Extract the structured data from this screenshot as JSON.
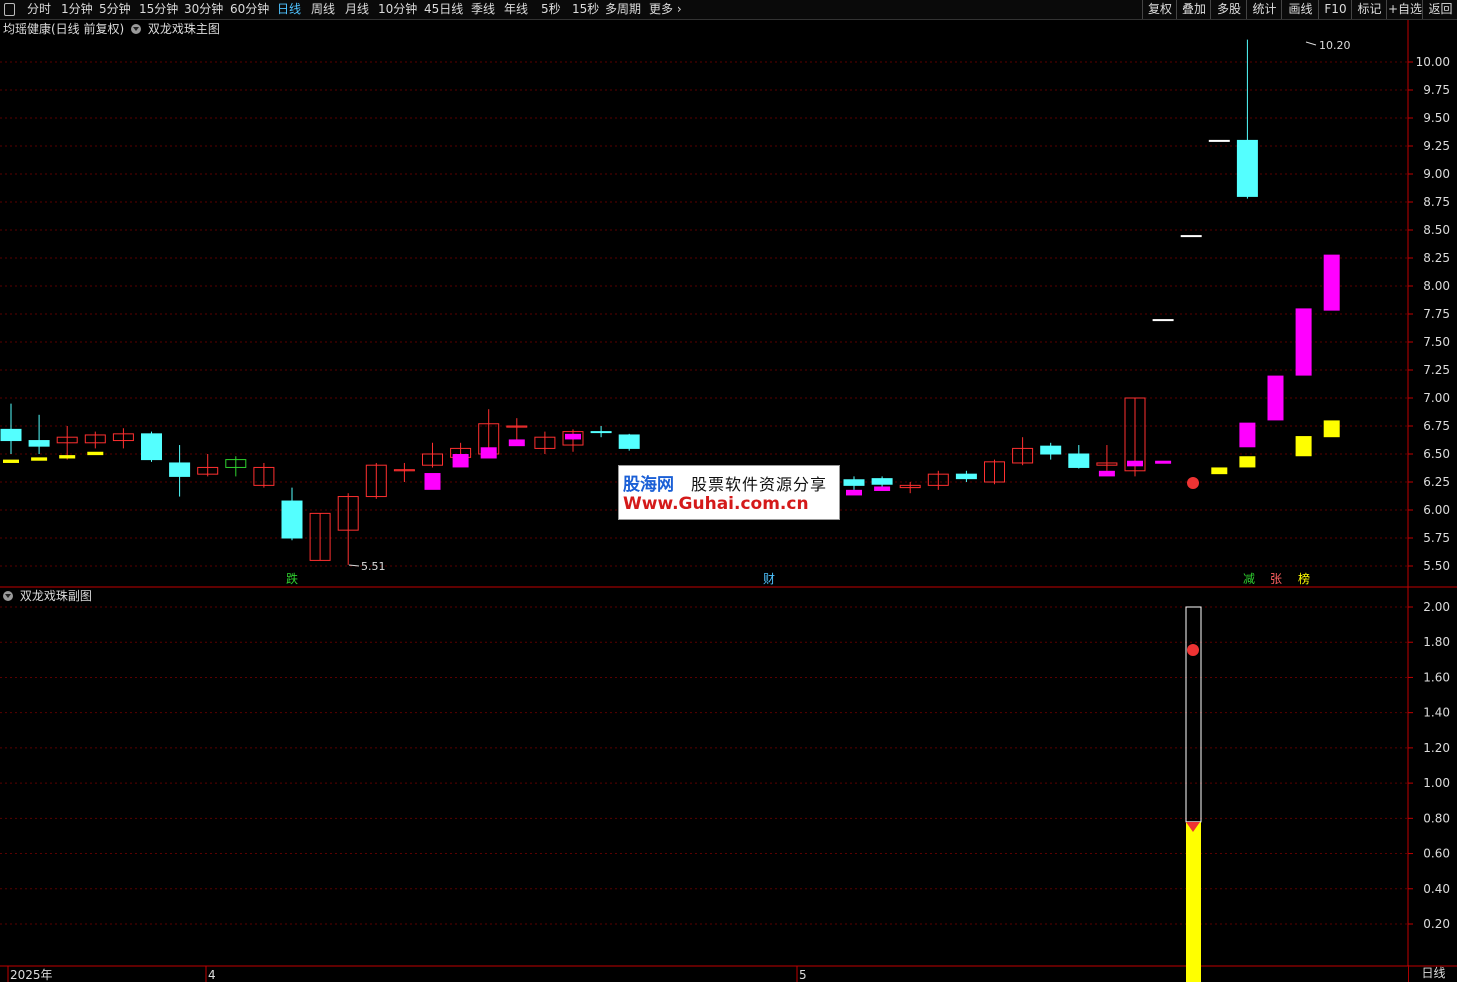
{
  "toolbar": {
    "menu_icon": "panel-toggle-icon",
    "periods": [
      "分时",
      "1分钟",
      "5分钟",
      "15分钟",
      "30分钟",
      "60分钟",
      "日线",
      "周线",
      "月线",
      "10分钟",
      "45日线",
      "季线",
      "年线",
      "5秒",
      "15秒",
      "多周期",
      "更多"
    ],
    "active_period": "日线",
    "more_icon": "chevron-right-icon",
    "right_buttons": [
      "复权",
      "叠加",
      "多股",
      "统计",
      "画线",
      "F10",
      "标记",
      "+自选",
      "返回"
    ]
  },
  "main_chart": {
    "stock_title": "均瑶健康(日线 前复权)",
    "indicator_name": "双龙戏珠主图",
    "y_ticks": [
      "10.00",
      "9.75",
      "9.50",
      "9.25",
      "9.00",
      "8.75",
      "8.50",
      "8.25",
      "8.00",
      "7.75",
      "7.50",
      "7.25",
      "7.00",
      "6.75",
      "6.50",
      "6.25",
      "6.00",
      "5.75",
      "5.50"
    ],
    "high_label": "10.20",
    "low_label": "5.51",
    "signal_labels": [
      "跌",
      "财",
      "减",
      "张",
      "榜"
    ]
  },
  "sub_chart": {
    "indicator_name": "双龙戏珠副图",
    "y_ticks": [
      "2.00",
      "1.80",
      "1.60",
      "1.40",
      "1.20",
      "1.00",
      "0.80",
      "0.60",
      "0.40",
      "0.20"
    ]
  },
  "x_axis": {
    "labels": [
      "2025年",
      "4",
      "5"
    ],
    "period_label": "日线"
  },
  "watermark": {
    "brand": "股海网",
    "slogan": "股票软件资源分享",
    "url": "Www.Guhai.com.cn"
  },
  "colors": {
    "background": "#000000",
    "up": "#ff3030",
    "down_cyan": "#54ffff",
    "magenta": "#ff00ff",
    "yellow": "#ffff00",
    "axis": "#c00000"
  },
  "chart_data": [
    {
      "type": "candlestick",
      "title": "双龙戏珠主图",
      "ylim": [
        5.4,
        10.3
      ],
      "candles": [
        {
          "o": 6.62,
          "h": 6.95,
          "l": 6.5,
          "c": 6.72,
          "col": "cyan"
        },
        {
          "o": 6.57,
          "h": 6.85,
          "l": 6.5,
          "c": 6.62,
          "col": "cyan"
        },
        {
          "o": 6.6,
          "h": 6.75,
          "l": 6.45,
          "c": 6.65,
          "col": "red"
        },
        {
          "o": 6.6,
          "h": 6.7,
          "l": 6.55,
          "c": 6.67,
          "col": "red"
        },
        {
          "o": 6.62,
          "h": 6.73,
          "l": 6.55,
          "c": 6.68,
          "col": "red"
        },
        {
          "o": 6.45,
          "h": 6.7,
          "l": 6.43,
          "c": 6.68,
          "col": "cyan"
        },
        {
          "o": 6.3,
          "h": 6.58,
          "l": 6.12,
          "c": 6.42,
          "col": "cyan"
        },
        {
          "o": 6.32,
          "h": 6.5,
          "l": 6.3,
          "c": 6.38,
          "col": "red"
        },
        {
          "o": 6.38,
          "h": 6.48,
          "l": 6.3,
          "c": 6.45,
          "col": "green"
        },
        {
          "o": 6.22,
          "h": 6.42,
          "l": 6.2,
          "c": 6.38,
          "col": "red"
        },
        {
          "o": 5.75,
          "h": 6.2,
          "l": 5.73,
          "c": 6.08,
          "col": "cyan"
        },
        {
          "o": 5.55,
          "h": 5.97,
          "l": 5.55,
          "c": 5.97,
          "col": "red"
        },
        {
          "o": 5.82,
          "h": 6.15,
          "l": 5.51,
          "c": 6.12,
          "col": "red"
        },
        {
          "o": 6.12,
          "h": 6.42,
          "l": 6.1,
          "c": 6.4,
          "col": "red"
        },
        {
          "o": 6.35,
          "h": 6.42,
          "l": 6.25,
          "c": 6.36,
          "col": "red"
        },
        {
          "o": 6.4,
          "h": 6.6,
          "l": 6.38,
          "c": 6.5,
          "col": "red"
        },
        {
          "o": 6.47,
          "h": 6.6,
          "l": 6.45,
          "c": 6.55,
          "col": "red"
        },
        {
          "o": 6.5,
          "h": 6.9,
          "l": 6.48,
          "c": 6.77,
          "col": "red"
        },
        {
          "o": 6.74,
          "h": 6.82,
          "l": 6.6,
          "c": 6.75,
          "col": "red"
        },
        {
          "o": 6.55,
          "h": 6.7,
          "l": 6.5,
          "c": 6.65,
          "col": "red"
        },
        {
          "o": 6.58,
          "h": 6.72,
          "l": 6.52,
          "c": 6.7,
          "col": "red"
        },
        {
          "o": 6.7,
          "h": 6.75,
          "l": 6.65,
          "c": 6.7,
          "col": "cyan"
        },
        {
          "o": 6.55,
          "h": 6.68,
          "l": 6.53,
          "c": 6.67,
          "col": "cyan"
        }
      ],
      "extra_candles": [
        {
          "o": 6.1,
          "h": 6.3,
          "l": 6.05,
          "c": 6.25,
          "col": "red"
        },
        {
          "o": 6.25,
          "h": 6.32,
          "l": 6.18,
          "c": 6.28,
          "col": "cyan"
        },
        {
          "o": 6.22,
          "h": 6.3,
          "l": 6.18,
          "c": 6.27,
          "col": "cyan"
        },
        {
          "o": 6.23,
          "h": 6.3,
          "l": 6.2,
          "c": 6.28,
          "col": "cyan"
        },
        {
          "o": 6.2,
          "h": 6.25,
          "l": 6.15,
          "c": 6.22,
          "col": "red"
        },
        {
          "o": 6.22,
          "h": 6.35,
          "l": 6.18,
          "c": 6.32,
          "col": "red"
        },
        {
          "o": 6.28,
          "h": 6.35,
          "l": 6.25,
          "c": 6.32,
          "col": "cyan"
        },
        {
          "o": 6.25,
          "h": 6.45,
          "l": 6.23,
          "c": 6.43,
          "col": "red"
        },
        {
          "o": 6.42,
          "h": 6.65,
          "l": 6.4,
          "c": 6.55,
          "col": "red"
        },
        {
          "o": 6.5,
          "h": 6.6,
          "l": 6.45,
          "c": 6.57,
          "col": "cyan"
        },
        {
          "o": 6.38,
          "h": 6.58,
          "l": 6.37,
          "c": 6.5,
          "col": "cyan"
        },
        {
          "o": 6.4,
          "h": 6.58,
          "l": 6.35,
          "c": 6.42,
          "col": "red"
        },
        {
          "o": 6.35,
          "h": 7.0,
          "l": 6.3,
          "c": 7.0,
          "col": "red"
        },
        {
          "o": 7.7,
          "h": 7.7,
          "l": 7.7,
          "c": 7.7,
          "col": "white"
        },
        {
          "o": 8.45,
          "h": 8.45,
          "l": 8.45,
          "c": 8.45,
          "col": "white"
        },
        {
          "o": 9.3,
          "h": 9.3,
          "l": 9.3,
          "c": 9.3,
          "col": "white"
        },
        {
          "o": 8.8,
          "h": 10.2,
          "l": 8.78,
          "c": 9.3,
          "col": "cyan"
        }
      ]
    },
    {
      "type": "bar",
      "title": "双龙戏珠副图",
      "ylim": [
        0,
        2.1
      ],
      "bars": [
        {
          "x": "last",
          "values": [
            0.78,
            2.0
          ]
        }
      ]
    }
  ]
}
